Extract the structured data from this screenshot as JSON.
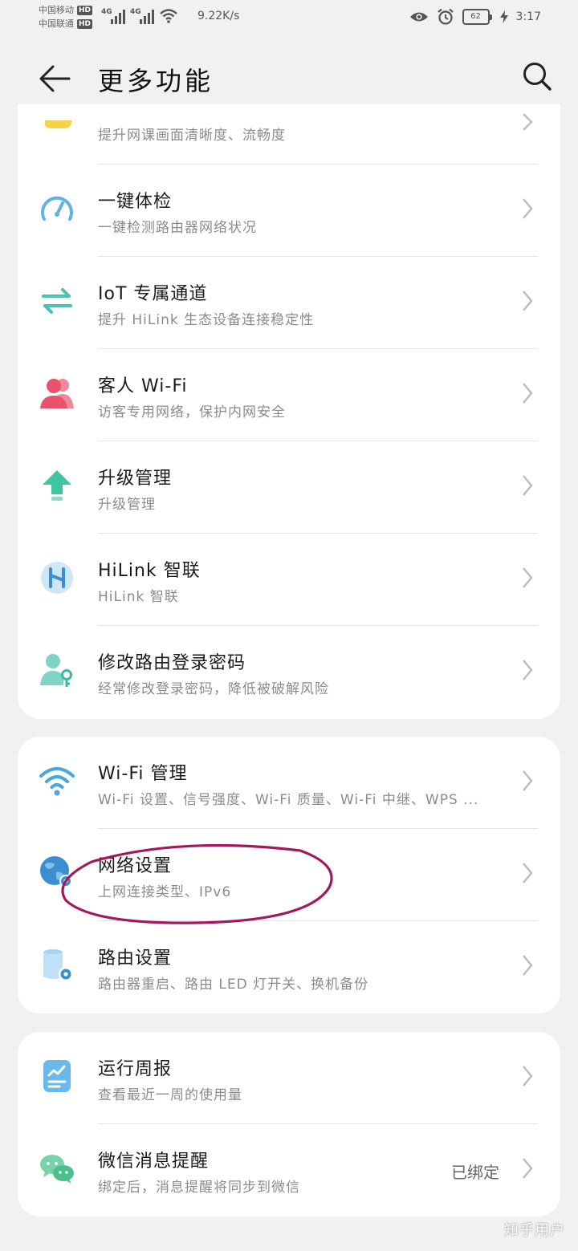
{
  "statusbar": {
    "carrier1": "中国移动",
    "carrier2": "中国联通",
    "hd": "HD",
    "network": "4G",
    "speed": "9.22K/s",
    "battery": "62",
    "time": "3:17"
  },
  "header": {
    "title": "更多功能"
  },
  "card1": {
    "partial_subtitle": "提升网课画面清晰度、流畅度",
    "items": [
      {
        "title": "一键体检",
        "subtitle": "一键检测路由器网络状况",
        "icon": "speedometer-icon"
      },
      {
        "title": "IoT 专属通道",
        "subtitle": "提升 HiLink 生态设备连接稳定性",
        "icon": "arrows-swap-icon"
      },
      {
        "title": "客人 Wi-Fi",
        "subtitle": "访客专用网络，保护内网安全",
        "icon": "guest-user-icon"
      },
      {
        "title": "升级管理",
        "subtitle": "升级管理",
        "icon": "upgrade-arrow-icon"
      },
      {
        "title": "HiLink 智联",
        "subtitle": "HiLink 智联",
        "icon": "hilink-icon"
      },
      {
        "title": "修改路由登录密码",
        "subtitle": "经常修改登录密码，降低被破解风险",
        "icon": "user-key-icon"
      }
    ]
  },
  "card2": {
    "items": [
      {
        "title": "Wi-Fi 管理",
        "subtitle": "Wi-Fi 设置、信号强度、Wi-Fi 质量、Wi-Fi 中继、WPS ...",
        "icon": "wifi-icon"
      },
      {
        "title": "网络设置",
        "subtitle": "上网连接类型、IPv6",
        "icon": "globe-gear-icon"
      },
      {
        "title": "路由设置",
        "subtitle": "路由器重启、路由 LED 灯开关、换机备份",
        "icon": "router-gear-icon"
      }
    ]
  },
  "card3": {
    "items": [
      {
        "title": "运行周报",
        "subtitle": "查看最近一周的使用量",
        "icon": "report-icon"
      },
      {
        "title": "微信消息提醒",
        "subtitle": "绑定后，消息提醒将同步到微信",
        "value": "已绑定",
        "icon": "wechat-icon"
      }
    ]
  },
  "watermark": "知乎用户",
  "colors": {
    "accent_blue": "#5fb3e6",
    "accent_teal": "#4bc1b4",
    "accent_red": "#e8526a",
    "accent_green": "#3fc6a0",
    "annotation": "#a3185a"
  }
}
